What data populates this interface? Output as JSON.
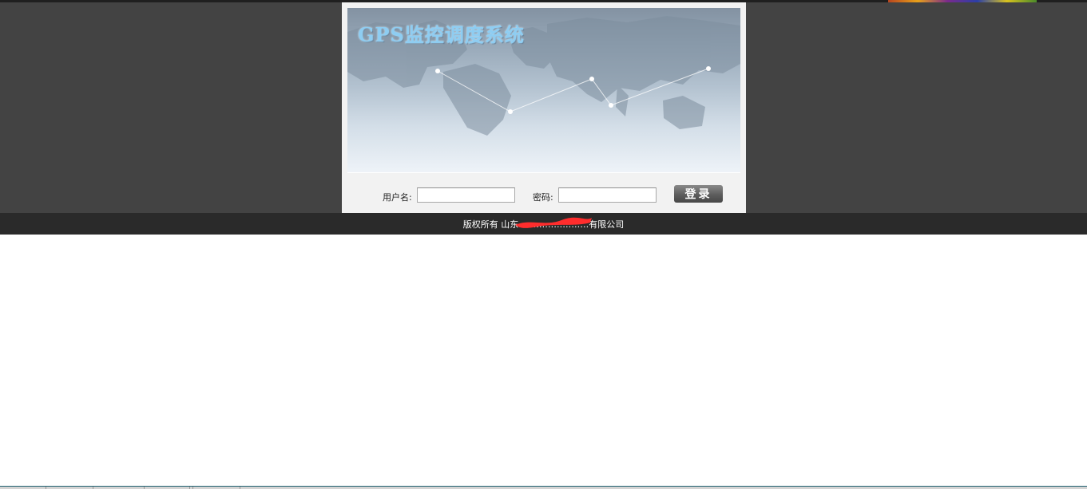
{
  "login": {
    "system_title": "GPS监控调度系统",
    "username_label": "用户名:",
    "username_value": "",
    "password_label": "密码:",
    "password_value": "",
    "login_button_label": "登录"
  },
  "footer": {
    "copyright": "版权所有 山东……………………有限公司"
  },
  "colors": {
    "page_band": "#434343",
    "footer": "#2a2a2a",
    "title_text": "#8ecdf2",
    "redaction_mark": "#ff2d2d"
  },
  "icons": {
    "banner_background": "world-map-icon",
    "banner_lines": "network-connection-icon",
    "redaction": "redaction-scribble"
  }
}
